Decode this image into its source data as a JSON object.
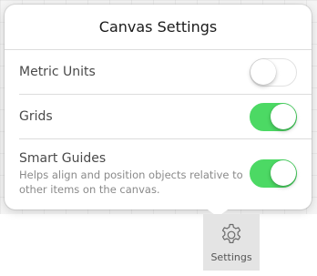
{
  "popover": {
    "title": "Canvas Settings",
    "rows": [
      {
        "label": "Metric Units",
        "description": "",
        "enabled": false
      },
      {
        "label": "Grids",
        "description": "",
        "enabled": true
      },
      {
        "label": "Smart Guides",
        "description": "Helps align and position objects relative to other items on the canvas.",
        "enabled": true
      }
    ]
  },
  "toolbar": {
    "settings_label": "Settings",
    "settings_icon": "gear-icon"
  },
  "colors": {
    "toggle_on": "#4cd964",
    "toggle_off_border": "#e2e2e2"
  }
}
